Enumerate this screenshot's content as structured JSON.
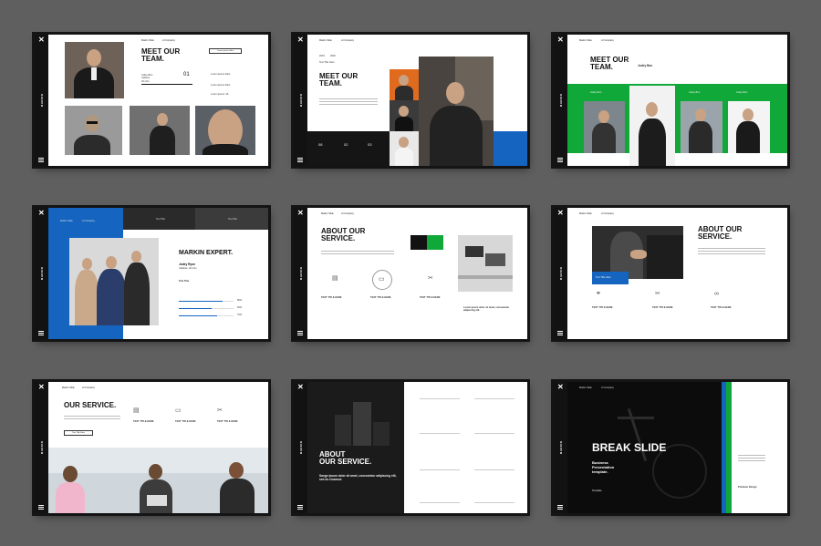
{
  "rail": {
    "brand": "MARKIN",
    "close_glyph": "✕"
  },
  "nav": [
    "Markin Slide",
    "Lil Company"
  ],
  "colors": {
    "blue": "#1565c0",
    "green": "#11a83a",
    "dark": "#121212"
  },
  "s1": {
    "title_l1": "MEET OUR",
    "title_l2": "TEAM.",
    "button": "Lorem ipsum dolor",
    "number": "01",
    "lorem1": "Lorem ipsum dolor",
    "lorem2": "Lorem ipsum: 46",
    "name_block": [
      "Jodey Bon",
      "Cafeine",
      "40 ohm"
    ]
  },
  "s2": {
    "year": "2019",
    "year2": "2020",
    "sub": "Text Title Here",
    "title_l1": "MEET OUR",
    "title_l2": "TEAM.",
    "stats": [
      "08",
      "02",
      "03"
    ]
  },
  "s3": {
    "title_l1": "MEET OUR",
    "title_l2": "TEAM.",
    "name": "Jodey Bon",
    "names": [
      "Jodey Bon",
      "Jodey Bon",
      "Jodey Bon",
      "Jodey Bon"
    ]
  },
  "s4": {
    "tabs": [
      "Text Title",
      "Text Title",
      "Text Title"
    ],
    "title": "MARKIN EXPERT.",
    "name": "Jodey Ryon",
    "role": "Caffeine, 40 ohm",
    "skill_label": "Text Title",
    "skill_values": [
      "80%",
      "60%",
      "70%"
    ]
  },
  "s5": {
    "title_l1": "ABOUT OUR",
    "title_l2": "SERVICE.",
    "items": [
      "TEXT TITLE HERE",
      "TEXT TITLE HERE",
      "TEXT TITLE HERE"
    ],
    "quote": "Lorem ipsum dolor sit amet, consectetur adipiscing elit."
  },
  "s6": {
    "title_l1": "ABOUT OUR",
    "title_l2": "SERVICE.",
    "badge": "Text Title Here",
    "items": [
      "TEXT TITLE HERE",
      "TEXT TITLE HERE",
      "TEXT TITLE HERE"
    ]
  },
  "s7": {
    "title": "OUR SERVICE.",
    "items": [
      "TEXT TITLE HERE",
      "TEXT TITLE HERE",
      "TEXT TITLE HERE"
    ],
    "button": "Text Title Here"
  },
  "s8": {
    "title_l1": "ABOUT",
    "title_l2": "OUR SERVICE.",
    "text_l1": "Sange ipsum dolor sit amet, consectetur adipiscing elit,",
    "text_l2": "sed do eiusmod."
  },
  "s9": {
    "title": "BREAK SLIDE",
    "sub_l1": "Business",
    "sub_l2": "Presentation",
    "sub_l3": "template.",
    "footer": "Template",
    "side_title": "Premium Design"
  }
}
